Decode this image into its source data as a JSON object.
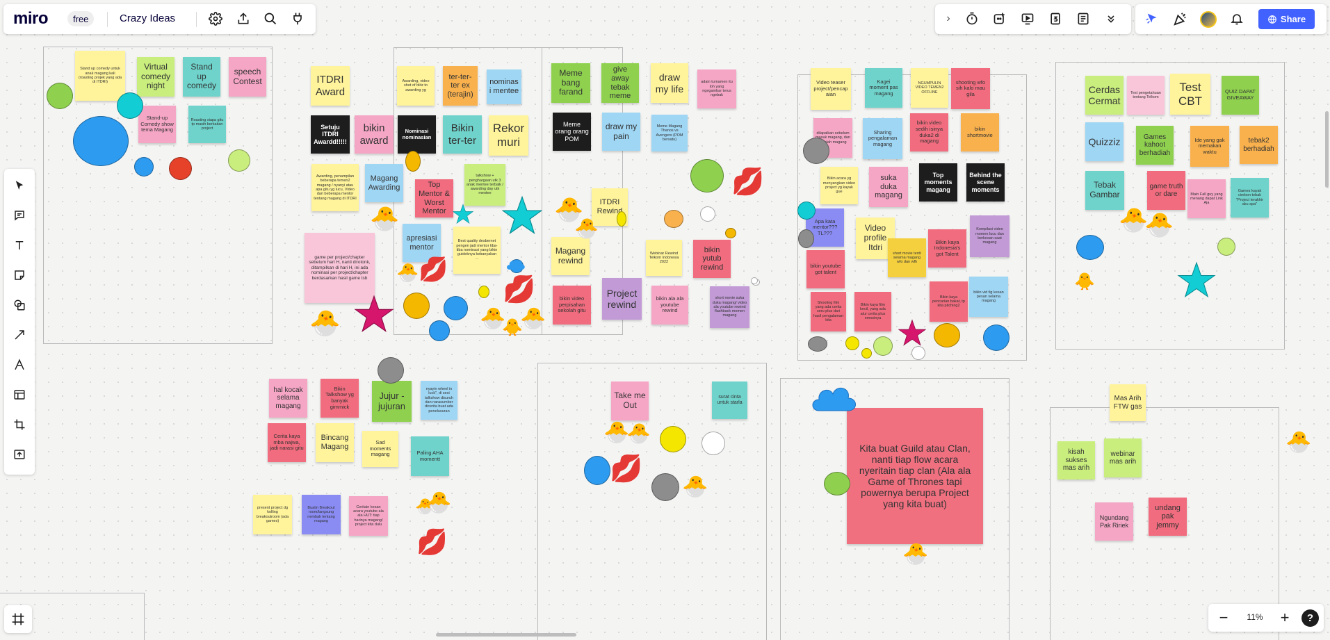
{
  "app": {
    "logo": "miro",
    "plan_badge": "free",
    "board_name": "Crazy Ideas",
    "share_label": "Share",
    "zoom": "11%",
    "help": "?"
  },
  "colors": {
    "accent": "#4262ff",
    "pink": "#f5a6c5",
    "yellow": "#fff49b",
    "green": "#c9ee7e",
    "blue": "#9fd6f4",
    "red": "#f06c7e",
    "orange": "#f9b14d",
    "teal": "#6fd3cb"
  },
  "icons": {
    "settings": "gear-icon",
    "export": "upload-icon",
    "search": "search-icon",
    "integrations": "plug-icon",
    "collapse": "chevron-right-icon",
    "timer": "timer-icon",
    "reactions": "reaction-icon",
    "present": "present-icon",
    "count": "counter-icon",
    "notes": "notes-icon",
    "more": "chevron-down-icon",
    "cursor": "pointer-icon",
    "celebrate": "confetti-icon",
    "bell": "bell-icon"
  },
  "tools": [
    "select-tool",
    "comment-tool",
    "text-tool",
    "sticky-note-tool",
    "shapes-tool",
    "connector-tool",
    "pen-tool",
    "frame-tool",
    "crop-tool",
    "upload-tool"
  ],
  "notes": {
    "n1": "Stand up comedy untuk anak magang kali (roasting projek yang ada di ITDRI)",
    "n2": "Virtual comedy night",
    "n3": "Stand up comedy",
    "n4": "speech Contest",
    "n5": "Stand-up Comedy show tema Magang",
    "n6": "Roasting siapa gitu tp masih berkaitan project",
    "a1": "ITDRI Award",
    "a2": "Awarding, video shot of blitz to awarding yg",
    "a3": "ter-ter-ter ex (terajin)",
    "a4": "nominasi mentee",
    "a5": "Setuju ITDRI Awardd!!!!!",
    "a6": "bikin award",
    "a7": "Nominasi nominasian",
    "a8": "Bikin ter-ter",
    "a9": "Rekor muri",
    "a10": "Awarding, penampilan beberapa temen2 magang / nyanyi atau apa gitu yg lucu, Video dari beberapa mentor tentang magang di ITDRI",
    "a11": "Magang Awarding",
    "a12": "Top Mentor & Worst Mentor",
    "a13": "talkshow + penghargaan utk 3 anak mentee terbaik / awarding day utk mentee",
    "a14": "game per project/chapter sebelum hari H, nanti dirotonk, ditampilkan di hari H, ini ada nominasi per project/chapter berdasarkan hasil game tsb",
    "a15": "apresiasi mentor",
    "a16": "Best quality desbernet pengen jadi mentor tiba-tiba nominasi yang bikin guideknya kebanyakan ...",
    "m1": "Meme bang farand",
    "m2": "give away tebak meme",
    "m3": "draw my life",
    "m4": "adain turnamen itu loh yang ngegambar terus ngebak",
    "m5": "Meme orang orang POM",
    "m6": "draw my pain",
    "m7": "Meme Magang Thanos vs Avengers (POM bersatu)",
    "r1": "ITDRI Rewind",
    "r2": "Magang rewind",
    "r3": "Webinar Rewind Telkom Indonesia 2022",
    "r4": "bikin yutub rewind",
    "r5": "bikin video perpisahan sekolah gitu",
    "r6": "Project rewind",
    "r7": "bikin ala ala youtube rewind",
    "r8": "short movie suka duka magang/ video ala youtube rewind flashback momen magang",
    "v1": "Video teaser project/pencapaian",
    "v2": "Kagei moment pas magang",
    "v3": "NGUMPULIN VIDEO TEMEN2 OFFLINE",
    "v4": "shooting wfo sih kalo mau gila",
    "v5": "dilapalkan sebelum masuk magang, dan setelah magang",
    "v6": "Sharing pengalaman magang",
    "v7": "bikin video sedih isinya duka2 di magang",
    "v8": "bikin shortmovie",
    "v9": "Bikin acara yg menyangkan video project yg kayak gue",
    "v10": "suka duka magang",
    "v11": "Top moments magang",
    "v12": "Behind the scene moments",
    "v13": "Apa kata mentor??? TL???",
    "v14": "Video profile Itdri",
    "v15": "short movie terdi selama magang wfo dan wfh",
    "v16": "Bikin kaya Indonesia's got Talent",
    "v17": "Kompilasi video momen lucu dan berkesan saat magang",
    "v18": "bikin youtube got talent",
    "v19": "Shooting film yang ada cerita seru plus dari hasil pengalaman kita",
    "v20": "Bikin kaya film kecil, yang ada alur cerita plus emosinya",
    "v21": "Bikin kaya pencarian bakat, tp kita pitching2",
    "v22": "bikin vid tlg kesan pesan selama magang",
    "g1": "Cerdas Cermat",
    "g2": "Test pengetahuan tentang Telkom",
    "g3": "Test CBT",
    "g4": "QUIZ DAPAT GIVEAWAY",
    "g5": "Quizziz",
    "g6": "Games kahoot berhadiah",
    "g7": "Ide yang gak memakan waktu",
    "g8": "tebak2 berhadiah",
    "g9": "Tebak Gambar",
    "g10": "game truth or dare",
    "g11": "Main Fall guy yang menang dapat Link Aja",
    "g12": "Games kayak cirebon tebak \"Project terakhir aku apa\"",
    "t1": "hal kocak selama magang",
    "t2": "Bikin Talkshow yg banyak gimmick",
    "t3": "Jujur - jujuran",
    "t4": "nyayin wheel in luck\", di sesi talkshow disuruh dan narasumber dicerita buat ada penelusuran",
    "t5": "Cerita kaya mba najwa, jadi narasi gitu",
    "t6": "Bincang Magang",
    "t7": "Sad moments magang",
    "t8": "Paling AHA momentt",
    "t9": "present project dg kolling breakoutroom (ada games)",
    "t10": "Buatin Breakout room/langsung nembak tentang magang",
    "t11": "Ceritain kesan acara youtube ala ala HUT: tiap harinya magang/ project kita dulu",
    "c1": "Take me Out",
    "c2": "surat cinta untuk starla",
    "k1": "Kita buat Guild atau Clan, nanti tiap flow acara nyeritain tiap clan (Ala ala Game of Thrones tapi powernya berupa Project yang kita buat)",
    "e1": "Mas Arih FTW gas",
    "e2": "kisah sukses mas arih",
    "e3": "webinar mas arih",
    "e4": "Ngundang Pak Ririek",
    "e5": "undang pak jemmy"
  }
}
